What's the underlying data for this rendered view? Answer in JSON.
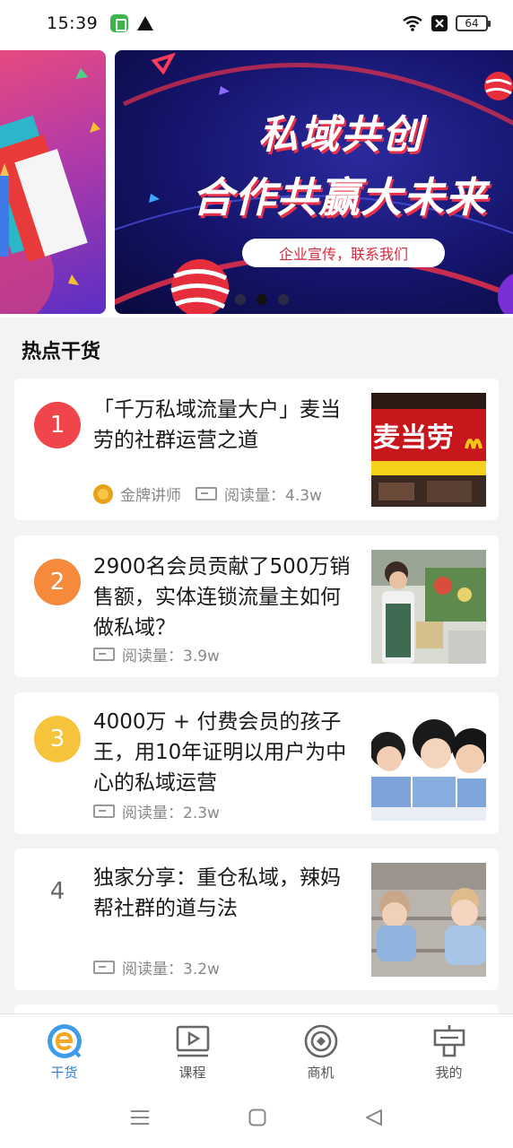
{
  "status_bar": {
    "time": "15:39",
    "battery": "64",
    "icons": [
      "app-notification-icon",
      "warning-icon",
      "wifi-icon",
      "no-sim-icon",
      "battery-icon"
    ]
  },
  "banner": {
    "line1": "私域共创",
    "line2": "合作共赢大未来",
    "pill": "企业宣传，联系我们",
    "slides": 3,
    "active_slide": 2
  },
  "section": {
    "title": "热点干货"
  },
  "articles": [
    {
      "rank": "1",
      "rank_color": "#f0454b",
      "title": "「千万私域流量大户」麦当劳的社群运营之道",
      "author": "金牌讲师",
      "reads": "阅读量：4.3w",
      "thumb": "mcdonalds-storefront"
    },
    {
      "rank": "2",
      "rank_color": "#f58a3d",
      "title": "2900名会员贡献了500万销售额，实体连锁流量主如何做私域？",
      "reads": "阅读量：3.9w",
      "thumb": "supermarket-staff"
    },
    {
      "rank": "3",
      "rank_color": "#f5c33c",
      "title": "4000万 + 付费会员的孩子王，用10年证明以用户为中心的私域运营",
      "reads": "阅读量：2.3w",
      "thumb": "smiling-children"
    },
    {
      "rank": "4",
      "rank_color": "",
      "title": "独家分享：重仓私域，辣妈帮社群的道与法",
      "reads": "阅读量：3.2w",
      "thumb": "babies-playing"
    }
  ],
  "nav": {
    "items": [
      {
        "label": "干货",
        "icon": "e-logo-icon",
        "active": true
      },
      {
        "label": "课程",
        "icon": "play-screen-icon",
        "active": false
      },
      {
        "label": "商机",
        "icon": "target-icon",
        "active": false
      },
      {
        "label": "我的",
        "icon": "profile-icon",
        "active": false
      }
    ]
  },
  "colors": {
    "accent": "#2e7fd6",
    "rank1": "#f0454b",
    "rank2": "#f58a3d",
    "rank3": "#f5c33c"
  }
}
